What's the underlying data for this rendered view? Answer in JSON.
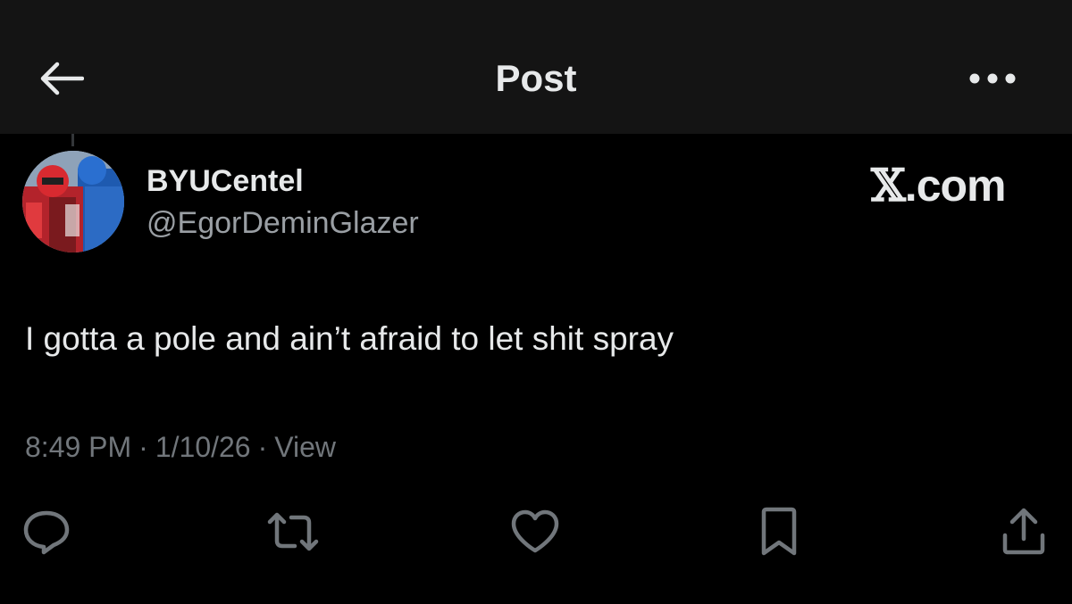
{
  "header": {
    "title": "Post",
    "back_icon": "arrow-left-icon",
    "more_icon": "more-horizontal-icon"
  },
  "post": {
    "author": {
      "display_name": "BYUCentel",
      "handle": "@EgorDeminGlazer",
      "avatar_icon": "avatar-image"
    },
    "watermark": {
      "x_glyph": "𝕏",
      "domain": ".com"
    },
    "text": "I gotta a pole and ain’t afraid to let shit spray",
    "time": "8:49 PM",
    "separator": "·",
    "date": "1/10/26",
    "views_label": "View"
  },
  "actions": [
    {
      "name": "reply",
      "icon": "reply-bubble-icon"
    },
    {
      "name": "repost",
      "icon": "repost-arrows-icon"
    },
    {
      "name": "like",
      "icon": "heart-icon"
    },
    {
      "name": "bookmark",
      "icon": "bookmark-icon"
    },
    {
      "name": "share",
      "icon": "share-icon"
    }
  ],
  "colors": {
    "background": "#000000",
    "header_background": "#141414",
    "primary_text": "#e7e9ea",
    "secondary_text": "#71767b",
    "icon": "#71767b"
  }
}
